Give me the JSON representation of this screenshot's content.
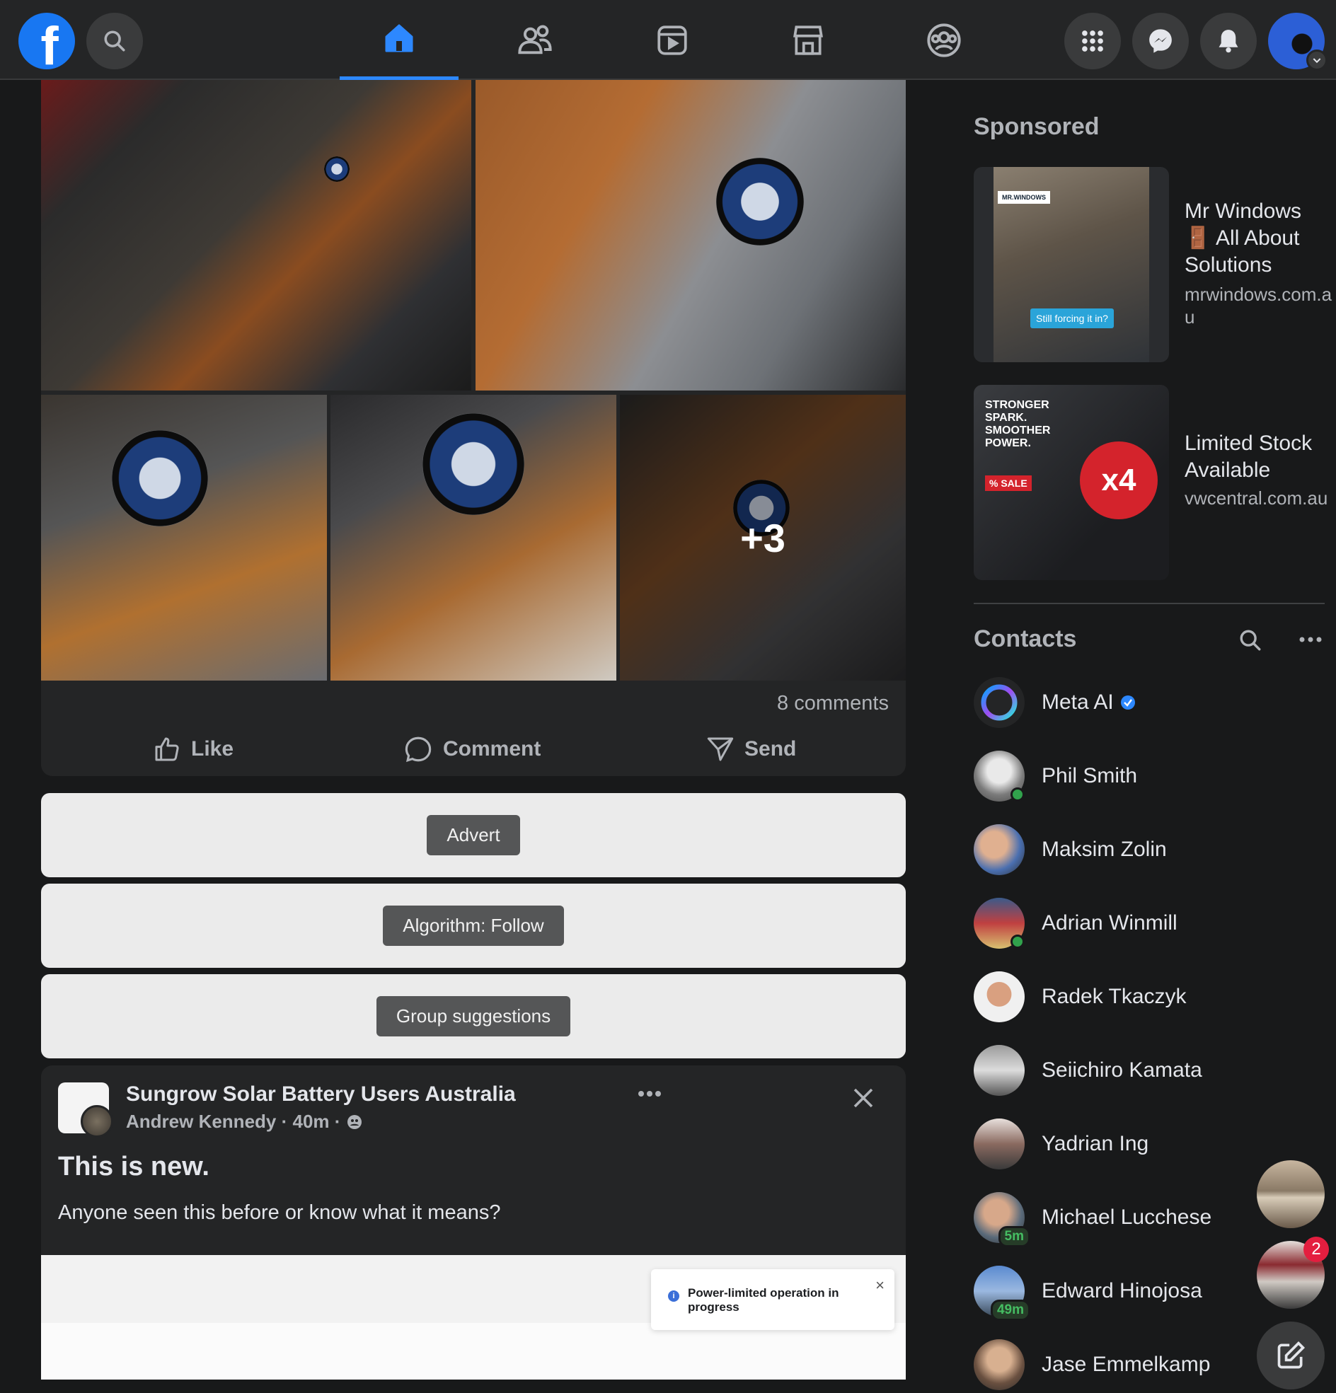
{
  "topbar": {
    "logo_letter": "f",
    "nav_tabs": [
      "home",
      "friends",
      "video",
      "marketplace",
      "groups"
    ]
  },
  "post": {
    "more_photos": "+3",
    "comments": "8 comments",
    "actions": {
      "like": "Like",
      "comment": "Comment",
      "send": "Send"
    }
  },
  "placeholders": [
    "Advert",
    "Algorithm: Follow",
    "Group suggestions"
  ],
  "post2": {
    "group": "Sungrow Solar Battery Users Australia",
    "author": "Andrew Kennedy",
    "time": "40m",
    "title": "This is new.",
    "body": "Anyone seen this before or know what it means?",
    "toast": "Power-limited operation in progress"
  },
  "sponsored": {
    "heading": "Sponsored",
    "ads": [
      {
        "title": "Mr Windows 🚪 All About Solutions",
        "url": "mrwindows.com.au",
        "image_caption": "Still forcing it in?",
        "image_brand": "MR.WINDOWS"
      },
      {
        "title": "Limited Stock Available",
        "url": "vwcentral.com.au",
        "image_headline": "STRONGER SPARK. SMOOTHER POWER.",
        "image_multiplier": "x4",
        "image_sale": "% SALE"
      }
    ]
  },
  "contacts": {
    "heading": "Contacts",
    "items": [
      {
        "name": "Meta AI",
        "verified": true
      },
      {
        "name": "Phil Smith",
        "online": true
      },
      {
        "name": "Maksim Zolin"
      },
      {
        "name": "Adrian Winmill",
        "online": true
      },
      {
        "name": "Radek Tkaczyk"
      },
      {
        "name": "Seiichiro Kamata"
      },
      {
        "name": "Yadrian Ing"
      },
      {
        "name": "Michael Lucchese",
        "badge": "5m"
      },
      {
        "name": "Edward Hinojosa",
        "badge": "49m"
      },
      {
        "name": "Jase Emmelkamp"
      }
    ]
  },
  "chat_heads": {
    "unread": "2"
  },
  "colors": {
    "accent": "#2d88ff",
    "online": "#31a24c",
    "badge": "#e41e3f",
    "background": "#18191a",
    "surface": "#242526"
  }
}
